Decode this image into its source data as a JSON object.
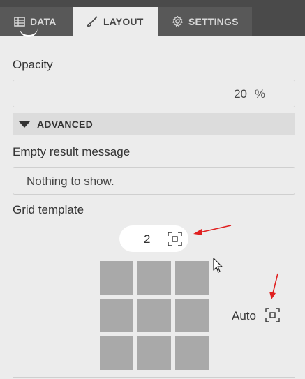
{
  "tabs": {
    "data_label": "DATA",
    "layout_label": "LAYOUT",
    "settings_label": "SETTINGS"
  },
  "opacity": {
    "label": "Opacity",
    "value": "20",
    "unit": "%"
  },
  "advanced": {
    "label": "ADVANCED"
  },
  "empty_result": {
    "label": "Empty result message",
    "value": "Nothing to show."
  },
  "grid_template": {
    "label": "Grid template",
    "column_count": "2",
    "auto_label": "Auto",
    "rows": 3,
    "cols": 3
  },
  "colors": {
    "accent_arrow": "#e02020",
    "tab_bg": "#4a4a4a",
    "cell": "#a9a9a9"
  },
  "icons": [
    "table-icon",
    "brush-icon",
    "gear-icon",
    "expand-icon",
    "cursor-icon"
  ]
}
